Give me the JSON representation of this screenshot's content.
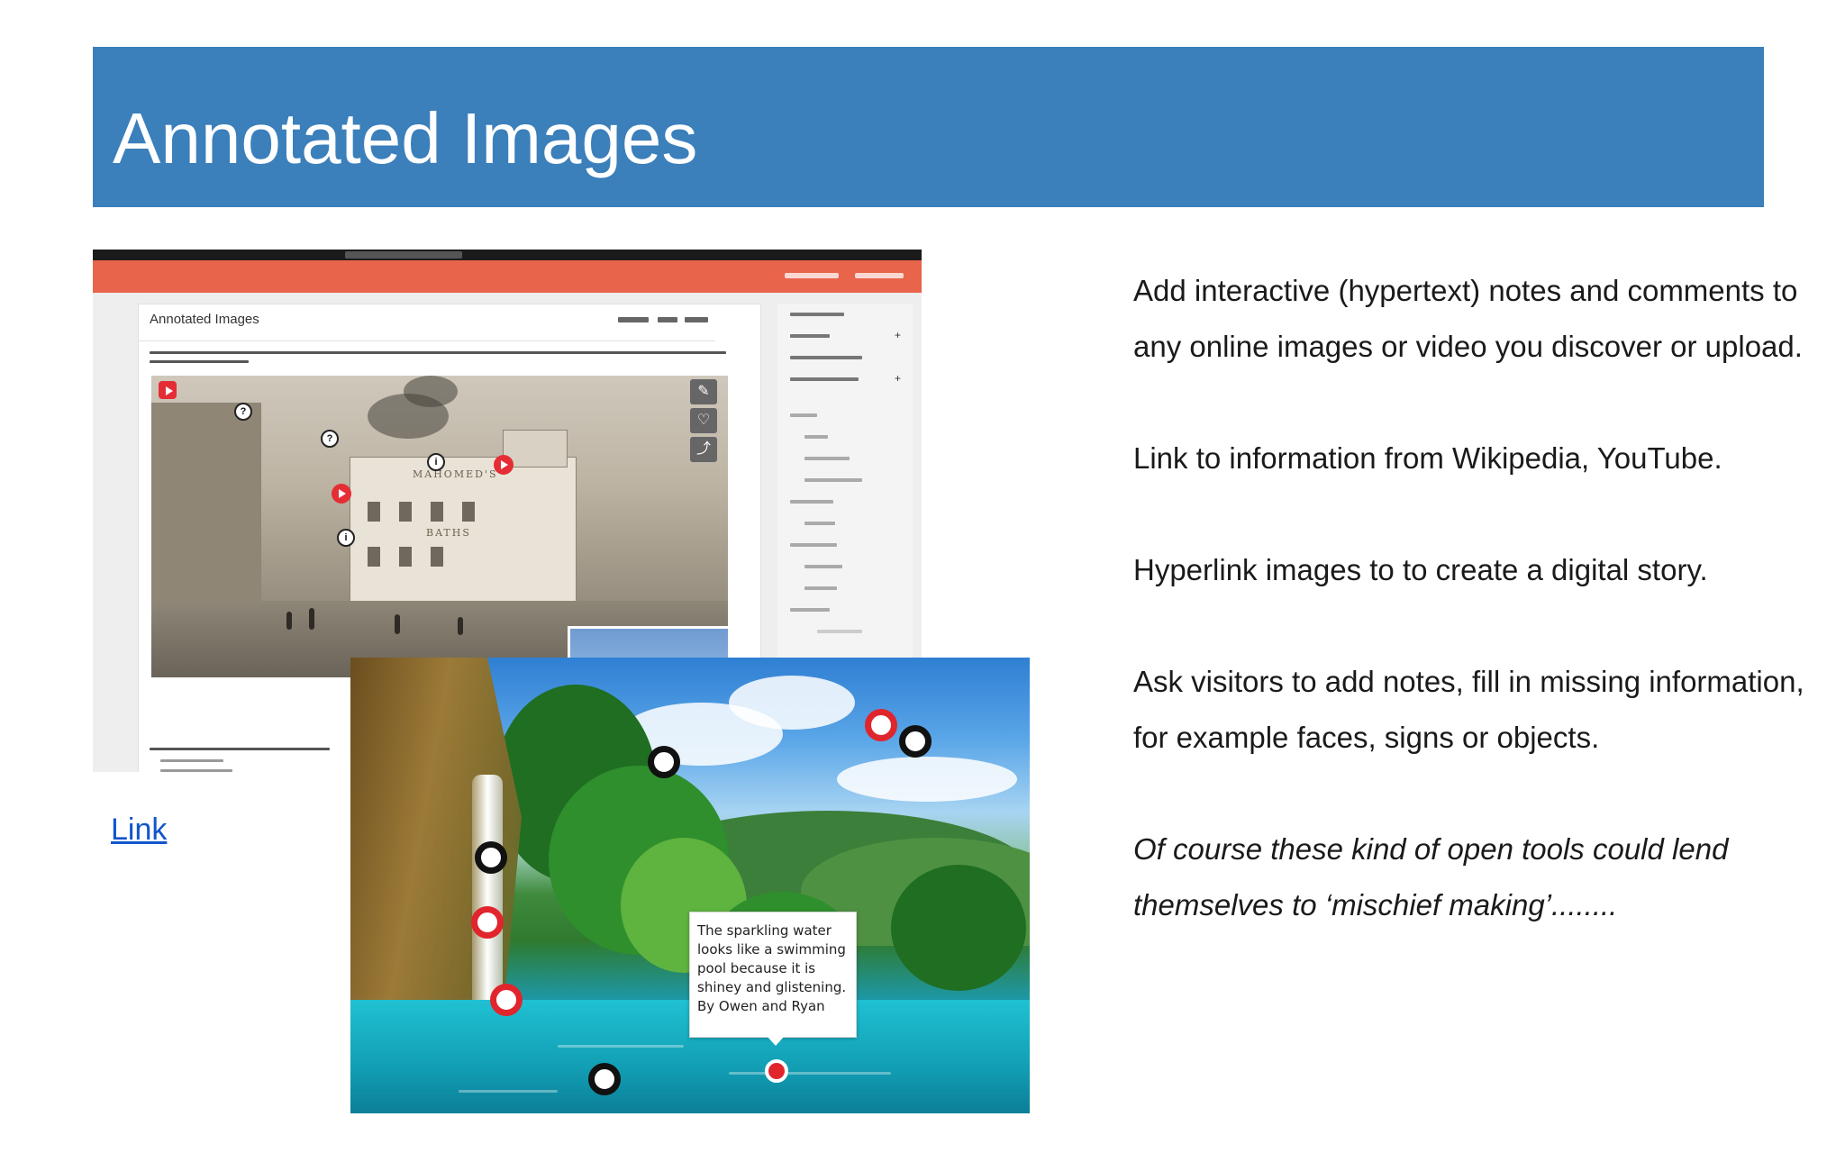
{
  "slide": {
    "title": "Annotated Images",
    "link_label": "Link"
  },
  "screenshot": {
    "wiki_page_title": "Annotated Images",
    "engraving_sign_1": "MAHOMED'S",
    "engraving_sign_2": "BATHS",
    "pin_question": "?",
    "pin_info": "i"
  },
  "waterfall": {
    "note": "The sparkling water looks like a swimming pool because it is shiney and glistening. By Owen and Ryan"
  },
  "text_column": {
    "paragraphs": [
      "Add interactive (hypertext) notes and comments to any  online images or video you discover or upload.",
      "Link to information from Wikipedia, YouTube.",
      "Hyperlink images to to create a digital story.",
      "Ask visitors to add notes, fill in missing information, for example faces, signs or objects."
    ],
    "closing_italic": "Of course these kind of open tools could lend themselves to ‘mischief making’........"
  },
  "colors": {
    "title_bar": "#3b7fbb",
    "wiki_header": "#e8644b",
    "link": "#1155cc",
    "pin_red": "#e0252c"
  }
}
